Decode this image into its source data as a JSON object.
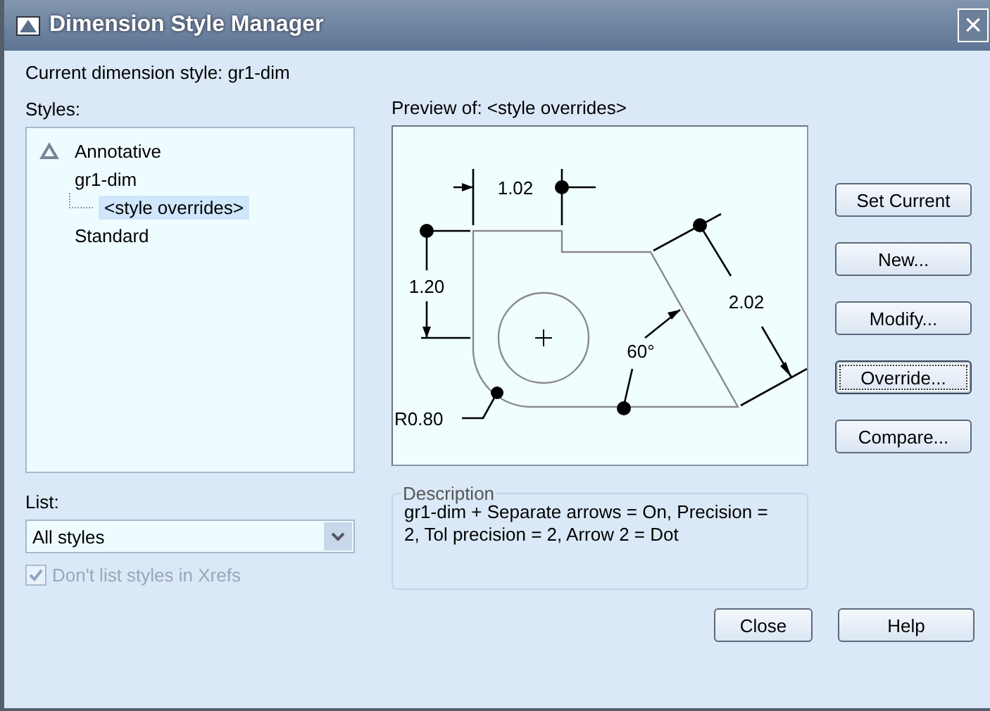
{
  "window": {
    "title": "Dimension Style Manager",
    "close": "×"
  },
  "current_style": "Current dimension style: gr1-dim",
  "styles": {
    "label": "Styles:",
    "items": [
      {
        "label": "Annotative",
        "annotative": true,
        "selected": false
      },
      {
        "label": "gr1-dim",
        "annotative": false,
        "selected": false,
        "children": [
          {
            "label": "<style overrides>",
            "annotative": false,
            "selected": true
          }
        ]
      },
      {
        "label": "Standard",
        "annotative": false,
        "selected": false
      }
    ]
  },
  "list": {
    "label": "List:",
    "value": "All styles"
  },
  "xref_checkbox": {
    "label": "Don't list styles in Xrefs",
    "checked": true,
    "disabled": true
  },
  "preview": {
    "label": "Preview of: <style overrides>",
    "dims": [
      "1.02",
      "1.20",
      "2.02",
      "60°",
      "R0.80"
    ]
  },
  "description": {
    "label": "Description",
    "text": "gr1-dim + Separate arrows = On, Precision = 2, Tol precision = 2, Arrow 2 = Dot"
  },
  "side_buttons": [
    {
      "label": "Set Current",
      "focused": false
    },
    {
      "label": "New...",
      "focused": false
    },
    {
      "label": "Modify...",
      "focused": false
    },
    {
      "label": "Override...",
      "focused": true
    },
    {
      "label": "Compare...",
      "focused": false
    }
  ],
  "bottom_buttons": [
    {
      "label": "Close",
      "focused": false
    },
    {
      "label": "Help",
      "focused": false
    }
  ]
}
